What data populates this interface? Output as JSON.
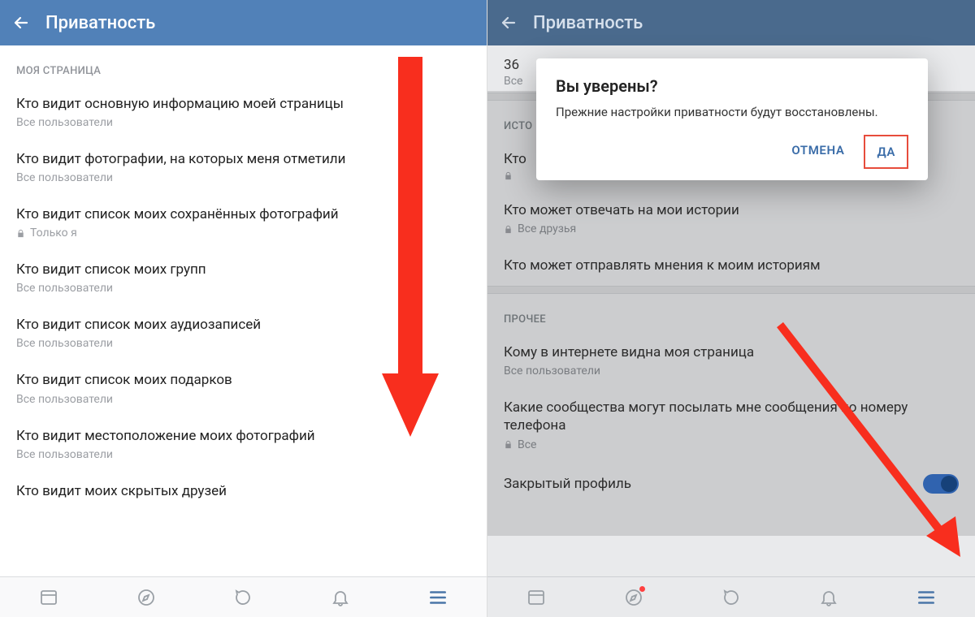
{
  "colors": {
    "accent": "#5181b8",
    "arrow": "#f82e1e"
  },
  "left": {
    "title": "Приватность",
    "section": "МОЯ СТРАНИЦА",
    "items": [
      {
        "title": "Кто видит основную информацию моей страницы",
        "sub": "Все пользователи",
        "locked": false
      },
      {
        "title": "Кто видит фотографии, на которых меня отметили",
        "sub": "Все пользователи",
        "locked": false
      },
      {
        "title": "Кто видит список моих сохранённых фотографий",
        "sub": "Только я",
        "locked": true
      },
      {
        "title": "Кто видит список моих групп",
        "sub": "Все пользователи",
        "locked": false
      },
      {
        "title": "Кто видит список моих аудиозаписей",
        "sub": "Все пользователи",
        "locked": false
      },
      {
        "title": "Кто видит список моих подарков",
        "sub": "Все пользователи",
        "locked": false
      },
      {
        "title": "Кто видит местоположение моих фотографий",
        "sub": "Все пользователи",
        "locked": false
      },
      {
        "title": "Кто видит моих скрытых друзей",
        "sub": "",
        "locked": false
      }
    ]
  },
  "right": {
    "title": "Приватность",
    "topSnippet": {
      "big": "36",
      "sm": "Все"
    },
    "sectionStories": "ИСТО",
    "storiesItems": [
      {
        "title": "Кто",
        "sub": "",
        "locked": true
      },
      {
        "title": "Кто может отвечать на мои истории",
        "sub": "Все друзья",
        "locked": true
      },
      {
        "title": "Кто может отправлять мнения к моим историям",
        "sub": "",
        "locked": false
      }
    ],
    "sectionOther": "ПРОЧЕЕ",
    "otherItems": [
      {
        "title": "Кому в интернете видна моя страница",
        "sub": "Все пользователи",
        "locked": false
      },
      {
        "title": "Какие сообщества могут посылать мне сообщения по номеру телефона",
        "sub": "Все",
        "locked": true
      }
    ],
    "toggleLabel": "Закрытый профиль",
    "dialog": {
      "title": "Вы уверены?",
      "body": "Прежние настройки приватности будут восстановлены.",
      "cancel": "ОТМЕНА",
      "ok": "ДА"
    }
  }
}
